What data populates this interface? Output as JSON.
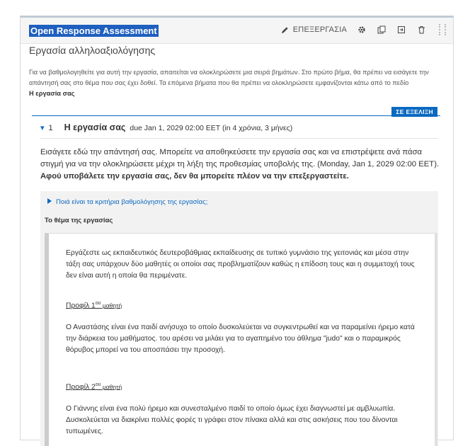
{
  "header": {
    "title": "Open Response Assessment",
    "edit_label": "ΕΠΕΞΕΡΓΑΣΙΑ"
  },
  "assessment": {
    "subtitle": "Εργασία αλληλοαξιολόγησης",
    "instructions": "Για να βαθμολογηθείτε για αυτή την εργασία, απαιτείται να ολοκληρώσετε μια σειρά βημάτων. Στο πρώτο βήμα, θα πρέπει να εισάγετε την απάντησή σας στο θέμα που σας έχει δοθεί. Τα επόμενα βήματα που θα πρέπει να ολοκληρώσετε εμφανίζονται κάτω από το πεδίο",
    "instructions_bold": "Η εργασία σας"
  },
  "step": {
    "status": "ΣΕ ΕΞΕΛΙΞΗ",
    "toggle": "▾",
    "number": "1",
    "title": "Η εργασία σας",
    "due": "due Jan 1, 2029 02:00 EET (in 4 χρόνια, 3 μήνες)",
    "text": "Εισάγετε εδώ την απάντησή σας. Μπορείτε να αποθηκεύσετε την εργασία σας και να επιστρέψετε ανά πάσα στιγμή για να την ολοκληρώσετε μέχρι τη λήξη της προθεσμίας υποβολής της. (Monday, Jan 1, 2029 02:00 EET).",
    "warning": "Αφού υποβάλετε την εργασία σας, δεν θα μπορείτε πλέον να την επεξεργαστείτε."
  },
  "rubric": {
    "toggle_label": "Ποιά είναι τα κριτήρια βαθμολόγησης της εργασίας;",
    "prompt_heading": "Το θέμα της εργασίας"
  },
  "prompt": {
    "intro": "Εργάζεστε ως εκπαιδευτικός δευτεροβάθμιας εκπαίδευσης σε τυπικό γυμνάσιο της γειτονιάς και μέσα στην τάξη σας υπάρχουν δύο μαθητές οι οποίοι σας προβληματίζουν καθώς η επίδοση τους και η συμμετοχή τους δεν είναι αυτή η οποία θα περιμένατε.",
    "profile1_label": "Προφίλ 1",
    "profile1_sup": "ου",
    "profile1_suffix": " μαθητή",
    "profile1_text": "Ο Αναστάσης είναι ένα παιδί ανήσυχο το οποίο δυσκολεύεται να συγκεντρωθεί και να παραμείνει ήρεμο κατά την διάρκεια του μαθήματος. του αρέσει να μιλάει για το αγαπημένο του άθλημα \"judo\" και ο παραμικρός θόρυβος  μπορεί να του αποσπάσει την προσοχή.",
    "profile2_label": "Προφίλ 2",
    "profile2_sup": "ου",
    "profile2_suffix": " μαθητή",
    "profile2_text": "Ο Γιάννης είναι ένα πολύ ήρεμο και συνεσταλμένο παιδί το οποίο όμως έχει διαγνωστεί με αμβλυωπία. Δυσκολεύεται να διακρίνει πολλές φορές τι γράφει στον πίνακα αλλά και στις ασκήσεις που του δίνονται τυπωμένες."
  },
  "icons": [
    "pencil-icon",
    "gear-icon",
    "duplicate-icon",
    "move-icon",
    "trash-icon",
    "drag-handle-icon",
    "caret-right-icon"
  ],
  "colors": {
    "accent": "#0b69c0",
    "title_highlight": "#1f5fbf"
  }
}
